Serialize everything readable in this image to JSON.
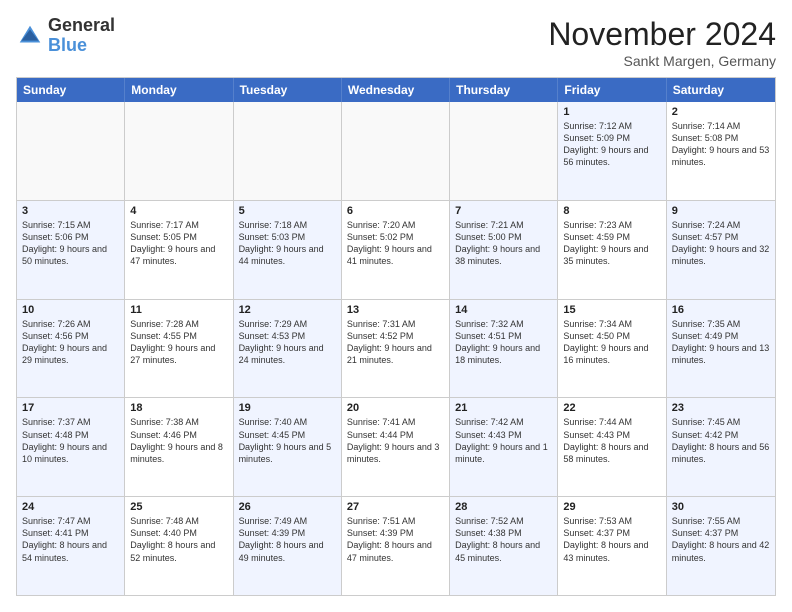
{
  "logo": {
    "line1": "General",
    "line2": "Blue"
  },
  "title": "November 2024",
  "subtitle": "Sankt Margen, Germany",
  "header_days": [
    "Sunday",
    "Monday",
    "Tuesday",
    "Wednesday",
    "Thursday",
    "Friday",
    "Saturday"
  ],
  "rows": [
    [
      {
        "day": "",
        "info": "",
        "empty": true
      },
      {
        "day": "",
        "info": "",
        "empty": true
      },
      {
        "day": "",
        "info": "",
        "empty": true
      },
      {
        "day": "",
        "info": "",
        "empty": true
      },
      {
        "day": "",
        "info": "",
        "empty": true
      },
      {
        "day": "1",
        "info": "Sunrise: 7:12 AM\nSunset: 5:09 PM\nDaylight: 9 hours and 56 minutes.",
        "shade": true
      },
      {
        "day": "2",
        "info": "Sunrise: 7:14 AM\nSunset: 5:08 PM\nDaylight: 9 hours and 53 minutes.",
        "shade": false
      }
    ],
    [
      {
        "day": "3",
        "info": "Sunrise: 7:15 AM\nSunset: 5:06 PM\nDaylight: 9 hours and 50 minutes.",
        "shade": true
      },
      {
        "day": "4",
        "info": "Sunrise: 7:17 AM\nSunset: 5:05 PM\nDaylight: 9 hours and 47 minutes.",
        "shade": false
      },
      {
        "day": "5",
        "info": "Sunrise: 7:18 AM\nSunset: 5:03 PM\nDaylight: 9 hours and 44 minutes.",
        "shade": true
      },
      {
        "day": "6",
        "info": "Sunrise: 7:20 AM\nSunset: 5:02 PM\nDaylight: 9 hours and 41 minutes.",
        "shade": false
      },
      {
        "day": "7",
        "info": "Sunrise: 7:21 AM\nSunset: 5:00 PM\nDaylight: 9 hours and 38 minutes.",
        "shade": true
      },
      {
        "day": "8",
        "info": "Sunrise: 7:23 AM\nSunset: 4:59 PM\nDaylight: 9 hours and 35 minutes.",
        "shade": false
      },
      {
        "day": "9",
        "info": "Sunrise: 7:24 AM\nSunset: 4:57 PM\nDaylight: 9 hours and 32 minutes.",
        "shade": true
      }
    ],
    [
      {
        "day": "10",
        "info": "Sunrise: 7:26 AM\nSunset: 4:56 PM\nDaylight: 9 hours and 29 minutes.",
        "shade": true
      },
      {
        "day": "11",
        "info": "Sunrise: 7:28 AM\nSunset: 4:55 PM\nDaylight: 9 hours and 27 minutes.",
        "shade": false
      },
      {
        "day": "12",
        "info": "Sunrise: 7:29 AM\nSunset: 4:53 PM\nDaylight: 9 hours and 24 minutes.",
        "shade": true
      },
      {
        "day": "13",
        "info": "Sunrise: 7:31 AM\nSunset: 4:52 PM\nDaylight: 9 hours and 21 minutes.",
        "shade": false
      },
      {
        "day": "14",
        "info": "Sunrise: 7:32 AM\nSunset: 4:51 PM\nDaylight: 9 hours and 18 minutes.",
        "shade": true
      },
      {
        "day": "15",
        "info": "Sunrise: 7:34 AM\nSunset: 4:50 PM\nDaylight: 9 hours and 16 minutes.",
        "shade": false
      },
      {
        "day": "16",
        "info": "Sunrise: 7:35 AM\nSunset: 4:49 PM\nDaylight: 9 hours and 13 minutes.",
        "shade": true
      }
    ],
    [
      {
        "day": "17",
        "info": "Sunrise: 7:37 AM\nSunset: 4:48 PM\nDaylight: 9 hours and 10 minutes.",
        "shade": true
      },
      {
        "day": "18",
        "info": "Sunrise: 7:38 AM\nSunset: 4:46 PM\nDaylight: 9 hours and 8 minutes.",
        "shade": false
      },
      {
        "day": "19",
        "info": "Sunrise: 7:40 AM\nSunset: 4:45 PM\nDaylight: 9 hours and 5 minutes.",
        "shade": true
      },
      {
        "day": "20",
        "info": "Sunrise: 7:41 AM\nSunset: 4:44 PM\nDaylight: 9 hours and 3 minutes.",
        "shade": false
      },
      {
        "day": "21",
        "info": "Sunrise: 7:42 AM\nSunset: 4:43 PM\nDaylight: 9 hours and 1 minute.",
        "shade": true
      },
      {
        "day": "22",
        "info": "Sunrise: 7:44 AM\nSunset: 4:43 PM\nDaylight: 8 hours and 58 minutes.",
        "shade": false
      },
      {
        "day": "23",
        "info": "Sunrise: 7:45 AM\nSunset: 4:42 PM\nDaylight: 8 hours and 56 minutes.",
        "shade": true
      }
    ],
    [
      {
        "day": "24",
        "info": "Sunrise: 7:47 AM\nSunset: 4:41 PM\nDaylight: 8 hours and 54 minutes.",
        "shade": true
      },
      {
        "day": "25",
        "info": "Sunrise: 7:48 AM\nSunset: 4:40 PM\nDaylight: 8 hours and 52 minutes.",
        "shade": false
      },
      {
        "day": "26",
        "info": "Sunrise: 7:49 AM\nSunset: 4:39 PM\nDaylight: 8 hours and 49 minutes.",
        "shade": true
      },
      {
        "day": "27",
        "info": "Sunrise: 7:51 AM\nSunset: 4:39 PM\nDaylight: 8 hours and 47 minutes.",
        "shade": false
      },
      {
        "day": "28",
        "info": "Sunrise: 7:52 AM\nSunset: 4:38 PM\nDaylight: 8 hours and 45 minutes.",
        "shade": true
      },
      {
        "day": "29",
        "info": "Sunrise: 7:53 AM\nSunset: 4:37 PM\nDaylight: 8 hours and 43 minutes.",
        "shade": false
      },
      {
        "day": "30",
        "info": "Sunrise: 7:55 AM\nSunset: 4:37 PM\nDaylight: 8 hours and 42 minutes.",
        "shade": true
      }
    ]
  ]
}
